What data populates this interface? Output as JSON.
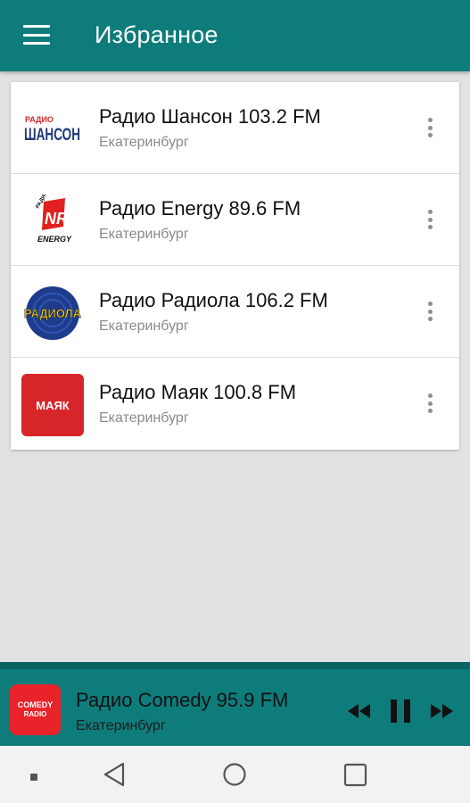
{
  "appbar": {
    "title": "Избранное",
    "menu_icon": "hamburger-icon"
  },
  "stations": [
    {
      "name": "Радио Шансон 103.2 FM",
      "city": "Екатеринбург",
      "logo_text_top": "РАДИО",
      "logo_text_main": "ШАНСОН"
    },
    {
      "name": "Радио Energy 89.6 FM",
      "city": "Екатеринбург",
      "logo_text_top": "РАДИО",
      "logo_text_main": "NRJ",
      "logo_text_bottom": "ENERGY"
    },
    {
      "name": "Радио Радиола 106.2 FM",
      "city": "Екатеринбург",
      "logo_text_main": "РАДИОЛА"
    },
    {
      "name": "Радио Маяк 100.8 FM",
      "city": "Екатеринбург",
      "logo_text_main": "МАЯК"
    }
  ],
  "player": {
    "title": "Радио Comedy 95.9 FM",
    "city": "Екатеринбург",
    "logo_text_top": "COMEDY",
    "logo_text_bottom": "RADIO",
    "controls": [
      "rewind-icon",
      "pause-icon",
      "fast-forward-icon"
    ]
  },
  "navbar": {
    "icons": [
      "recents-dot-icon",
      "back-triangle-icon",
      "home-circle-icon",
      "overview-square-icon"
    ]
  },
  "colors": {
    "primary": "#0e7c7b",
    "primary_dark": "#0a6464",
    "mayak_red": "#d7262a",
    "comedy_red": "#e8232a",
    "shanson_blue": "#1d3a7a"
  }
}
